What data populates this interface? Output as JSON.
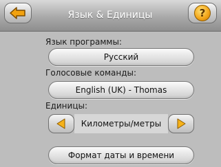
{
  "header": {
    "title": "Язык & Единицы",
    "back_icon": "back-arrow-icon",
    "help_label": "?"
  },
  "language": {
    "label": "Язык программы:",
    "value": "Русский"
  },
  "voice": {
    "label": "Голосовые команды:",
    "value": "English (UK) - Thomas"
  },
  "units": {
    "label": "Единицы:",
    "value": "Километры/метры",
    "prev_icon": "triangle-left-icon",
    "next_icon": "triangle-right-icon"
  },
  "date_time_button": "Формат даты и времени",
  "colors": {
    "header_top": "#d9d9d9",
    "panel_bg": "#bdbdbd",
    "accent_orange": "#f4a81c"
  }
}
